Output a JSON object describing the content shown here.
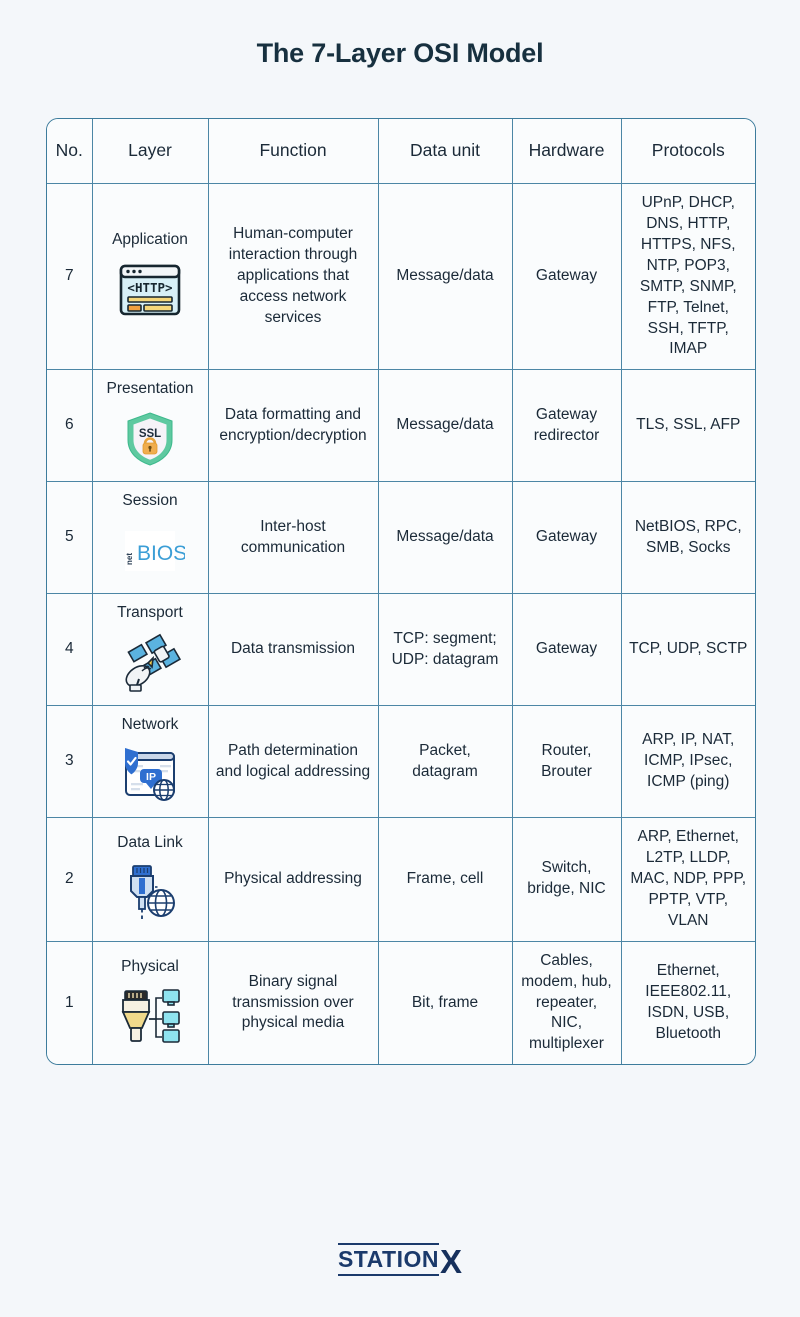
{
  "title": "The 7-Layer OSI Model",
  "table": {
    "headers": [
      "No.",
      "Layer",
      "Function",
      "Data unit",
      "Hardware",
      "Protocols"
    ],
    "rows": [
      {
        "no": "7",
        "layer": "Application",
        "icon": "http-browser-window-icon",
        "function": "Human-computer interaction through applications that access network services",
        "data_unit": "Message/data",
        "hardware": "Gateway",
        "protocols": "UPnP, DHCP, DNS, HTTP, HTTPS, NFS, NTP, POP3, SMTP, SNMP, FTP, Telnet, SSH, TFTP, IMAP"
      },
      {
        "no": "6",
        "layer": "Presentation",
        "icon": "ssl-shield-lock-icon",
        "function": "Data formatting and encryption/decryption",
        "data_unit": "Message/data",
        "hardware": "Gateway redirector",
        "protocols": "TLS, SSL, AFP"
      },
      {
        "no": "5",
        "layer": "Session",
        "icon": "netbios-logo-icon",
        "function": "Inter-host communication",
        "data_unit": "Message/data",
        "hardware": "Gateway",
        "protocols": "NetBIOS, RPC, SMB, Socks"
      },
      {
        "no": "4",
        "layer": "Transport",
        "icon": "satellite-dish-icon",
        "function": "Data transmission",
        "data_unit": "TCP: segment; UDP: datagram",
        "hardware": "Gateway",
        "protocols": "TCP, UDP, SCTP"
      },
      {
        "no": "3",
        "layer": "Network",
        "icon": "ip-shield-globe-icon",
        "function": "Path determination and logical addressing",
        "data_unit": "Packet, datagram",
        "hardware": "Router, Brouter",
        "protocols": "ARP, IP, NAT, ICMP, IPsec, ICMP (ping)"
      },
      {
        "no": "2",
        "layer": "Data Link",
        "icon": "ethernet-plug-globe-icon",
        "function": "Physical addressing",
        "data_unit": "Frame, cell",
        "hardware": "Switch, bridge, NIC",
        "protocols": "ARP, Ethernet, L2TP, LLDP, MAC, NDP, PPP, PPTP, VTP, VLAN"
      },
      {
        "no": "1",
        "layer": "Physical",
        "icon": "rj45-cable-monitors-icon",
        "function": "Binary signal transmission over physical media",
        "data_unit": "Bit, frame",
        "hardware": "Cables, modem, hub, repeater, NIC, multiplexer",
        "protocols": "Ethernet, IEEE802.11, ISDN, USB, Bluetooth"
      }
    ]
  },
  "footer": {
    "logo_text": "STATION",
    "logo_mark": "X"
  },
  "colors": {
    "page_background": "#f4f7fa",
    "table_border": "#4c86a5",
    "title_text": "#17303f",
    "cell_background": "#fafcfd",
    "logo": "#1b3a6b"
  }
}
